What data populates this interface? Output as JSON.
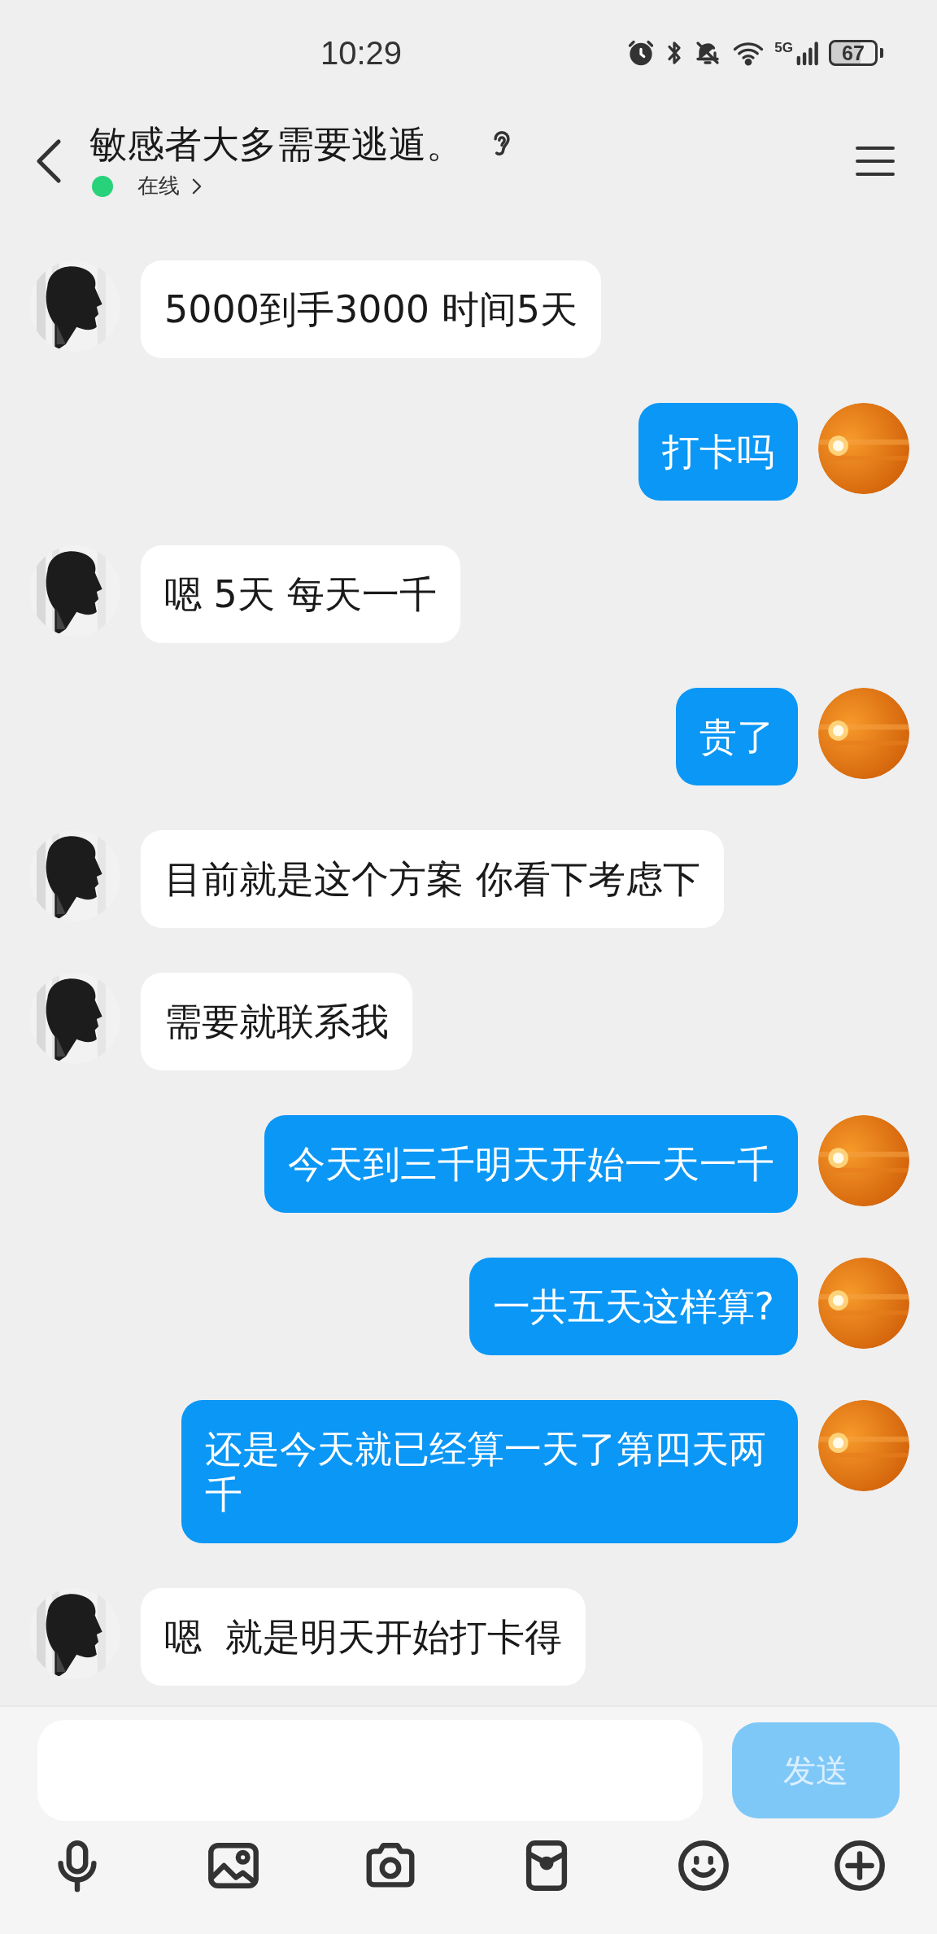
{
  "status_bar": {
    "time": "10:29",
    "network": "5G",
    "battery": "67"
  },
  "header": {
    "title": "敏感者大多需要逃遁。",
    "presence": "在线"
  },
  "messages": [
    {
      "kind": "incoming",
      "text": "5000到手3000 时间5天"
    },
    {
      "kind": "outgoing",
      "text": "打卡吗"
    },
    {
      "kind": "incoming",
      "text": "嗯 5天 每天一千"
    },
    {
      "kind": "outgoing",
      "text": "贵了"
    },
    {
      "kind": "incoming",
      "text": "目前就是这个方案 你看下考虑下"
    },
    {
      "kind": "incoming",
      "text": "需要就联系我"
    },
    {
      "kind": "outgoing",
      "text": "今天到三千明天开始一天一千"
    },
    {
      "kind": "outgoing",
      "text": "一共五天这样算?"
    },
    {
      "kind": "outgoing",
      "text": "还是今天就已经算一天了第四天两千"
    },
    {
      "kind": "incoming",
      "text": "嗯  就是明天开始打卡得"
    }
  ],
  "composer": {
    "send_label": "发送",
    "disabled": true
  }
}
